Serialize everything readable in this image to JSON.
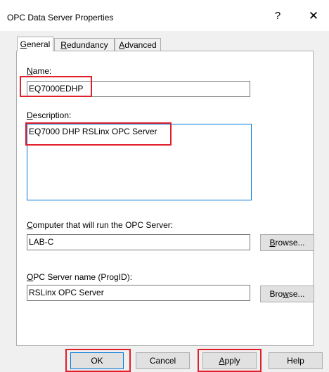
{
  "window": {
    "title": "OPC Data Server Properties",
    "help_glyph": "?",
    "close_glyph": "✕"
  },
  "tabs": [
    {
      "pre": "",
      "key": "G",
      "post": "eneral"
    },
    {
      "pre": "",
      "key": "R",
      "post": "edundancy"
    },
    {
      "pre": "",
      "key": "A",
      "post": "dvanced"
    }
  ],
  "fields": {
    "name": {
      "label_key": "N",
      "label_rest": "ame:",
      "value": "EQ7000EDHP"
    },
    "description": {
      "label_key": "D",
      "label_rest": "escription:",
      "value": "EQ7000 DHP RSLinx OPC Server"
    },
    "computer": {
      "label_key": "C",
      "label_rest": "omputer that will run the OPC Server:",
      "value": "LAB-C"
    },
    "progid": {
      "label_key": "O",
      "label_rest": "PC Server name (ProgID):",
      "value": "RSLinx OPC Server"
    }
  },
  "buttons": {
    "browse1": {
      "pre": "",
      "key": "B",
      "post": "rowse..."
    },
    "browse2": {
      "pre": "Bro",
      "key": "w",
      "post": "se..."
    },
    "ok": "OK",
    "cancel": "Cancel",
    "apply": {
      "pre": "",
      "key": "A",
      "post": "pply"
    },
    "help": "Help"
  },
  "highlight_color": "#e0202a"
}
